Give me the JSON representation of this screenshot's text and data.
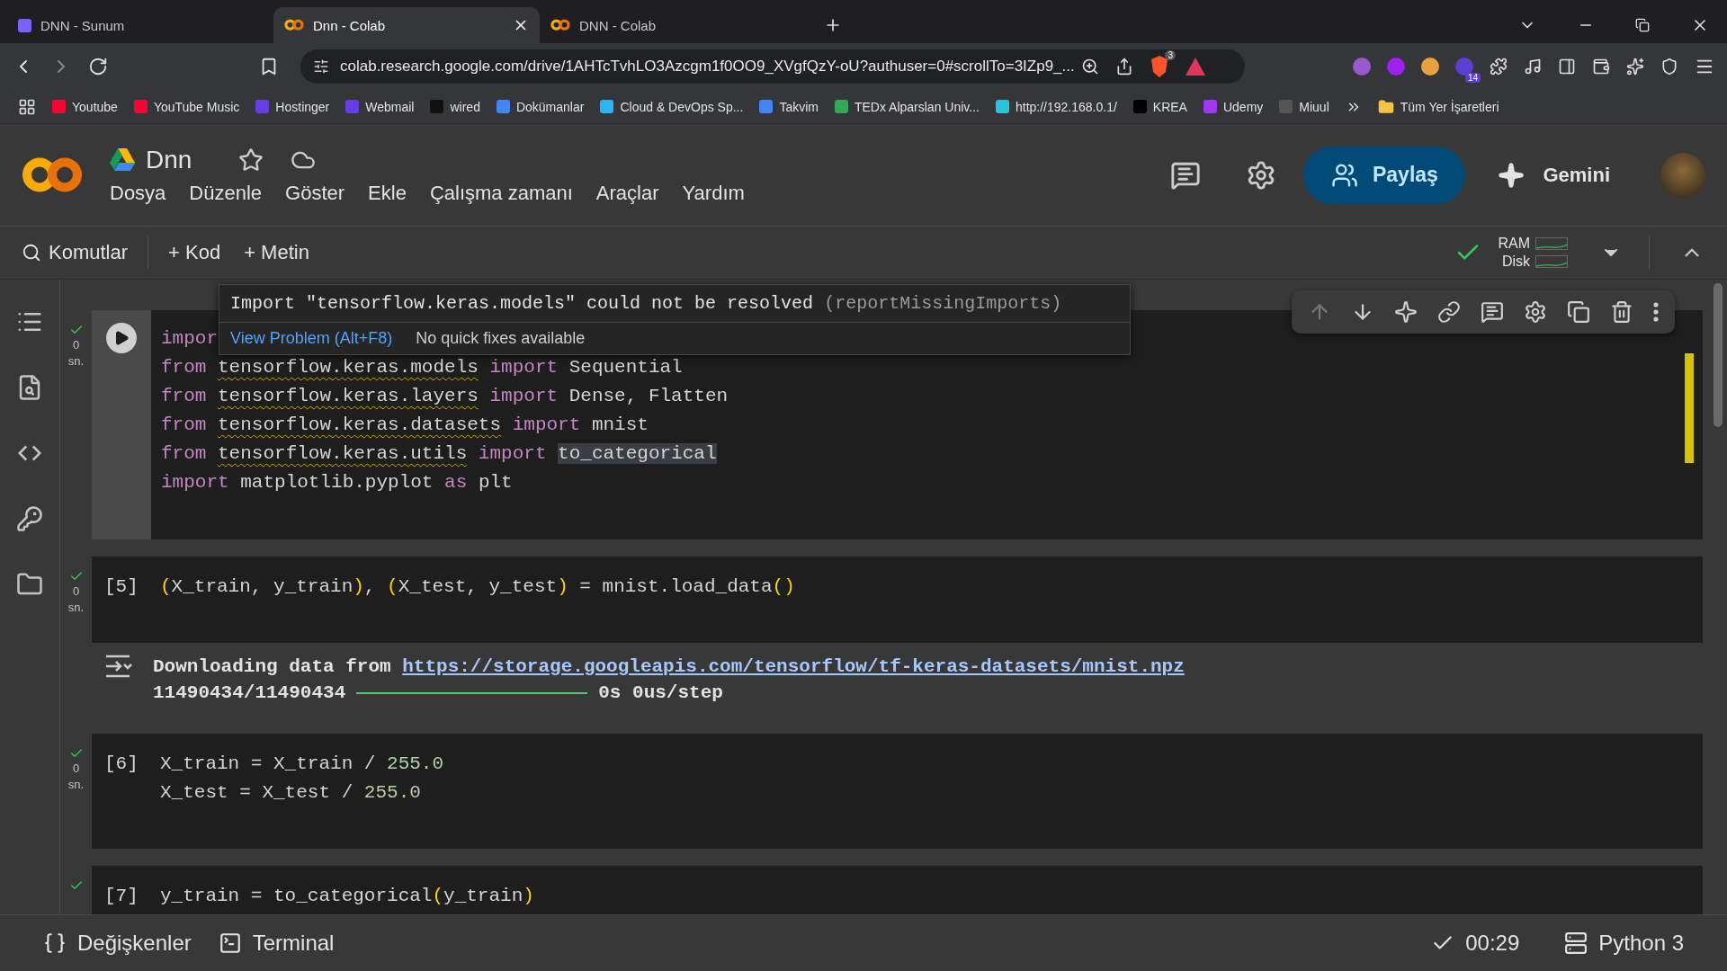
{
  "browser": {
    "tabs": [
      {
        "title": "DNN - Sunum",
        "selected": false,
        "kind": "slides"
      },
      {
        "title": "Dnn - Colab",
        "selected": true,
        "kind": "colab"
      },
      {
        "title": "DNN - Colab",
        "selected": false,
        "kind": "colab"
      }
    ],
    "url": "colab.research.google.com/drive/1AHTcTvhLO3Azcgm1f0OO9_XVgfQzY-oU?authuser=0#scrollTo=3IZp9_...",
    "shield_count": "3",
    "extensions": [
      {
        "color": "#9b59d0"
      },
      {
        "color": "#a020f0"
      },
      {
        "color": "#e8a33d"
      },
      {
        "color": "#5b3fd0",
        "badge": "14"
      }
    ],
    "bookmarks": [
      {
        "label": "Youtube",
        "color": "#ff0033"
      },
      {
        "label": "YouTube Music",
        "color": "#ff0033"
      },
      {
        "label": "Hostinger",
        "color": "#673de6"
      },
      {
        "label": "Webmail",
        "color": "#673de6"
      },
      {
        "label": "wired",
        "color": "#111111"
      },
      {
        "label": "Dokümanlar",
        "color": "#4285f4"
      },
      {
        "label": "Cloud & DevOps Sp...",
        "color": "#29b6f6"
      },
      {
        "label": "Takvim",
        "color": "#4285f4"
      },
      {
        "label": "TEDx Alparslan Univ...",
        "color": "#34a853"
      },
      {
        "label": "http://192.168.0.1/",
        "color": "#26c6da"
      },
      {
        "label": "KREA",
        "color": "#000000"
      },
      {
        "label": "Udemy",
        "color": "#a435f0"
      },
      {
        "label": "Miuul",
        "color": "#555555"
      }
    ],
    "all_bookmarks": "Tüm Yer İşaretleri"
  },
  "notebook": {
    "title": "Dnn",
    "menu": [
      "Dosya",
      "Düzenle",
      "Göster",
      "Ekle",
      "Çalışma zamanı",
      "Araçlar",
      "Yardım"
    ],
    "share": "Paylaş",
    "gemini": "Gemini",
    "toolbar": {
      "commands": "Komutlar",
      "add_code": "+ Kod",
      "add_text": "+ Metin",
      "ram": "RAM",
      "disk": "Disk"
    }
  },
  "cell_toolbar": [
    {
      "disabled": true
    },
    {
      "disabled": false
    },
    {
      "disabled": false
    },
    {
      "disabled": false
    },
    {
      "disabled": false
    },
    {
      "disabled": false
    },
    {
      "disabled": false
    },
    {
      "disabled": false
    },
    {
      "disabled": false
    }
  ],
  "tooltip": {
    "message": "Import \"tensorflow.keras.models\" could not be resolved",
    "rule": "(reportMissingImports)",
    "action": "View Problem (Alt+F8)",
    "note": "No quick fixes available"
  },
  "cells": [
    {
      "kind": "editor",
      "status": "0",
      "unit": "sn.",
      "lines": [
        [
          {
            "kind": "kw",
            "text": "impor"
          }
        ],
        [
          {
            "kind": "kw",
            "text": "from "
          },
          {
            "kind": "mod",
            "text": "tensorflow.keras.models"
          },
          {
            "kind": "kw",
            "text": " import "
          },
          {
            "kind": "plain",
            "text": "Sequential"
          }
        ],
        [
          {
            "kind": "kw",
            "text": "from "
          },
          {
            "kind": "mod",
            "text": "tensorflow.keras.layers"
          },
          {
            "kind": "kw",
            "text": " import "
          },
          {
            "kind": "plain",
            "text": "Dense, Flatten"
          }
        ],
        [
          {
            "kind": "kw",
            "text": "from "
          },
          {
            "kind": "mod",
            "text": "tensorflow.keras.datasets"
          },
          {
            "kind": "kw",
            "text": " import "
          },
          {
            "kind": "plain",
            "text": "mnist"
          }
        ],
        [
          {
            "kind": "kw",
            "text": "from "
          },
          {
            "kind": "mod",
            "text": "tensorflow.keras.utils"
          },
          {
            "kind": "kw",
            "text": " import "
          },
          {
            "kind": "hl",
            "text": "to_categorical"
          }
        ],
        [
          {
            "kind": "kw",
            "text": "import "
          },
          {
            "kind": "plain",
            "text": "matplotlib.pyplot "
          },
          {
            "kind": "kw",
            "text": "as "
          },
          {
            "kind": "plain",
            "text": "plt"
          }
        ]
      ]
    },
    {
      "kind": "code",
      "prompt": "[5]",
      "status": "0",
      "unit": "sn.",
      "lines": [
        [
          {
            "kind": "paren",
            "text": "("
          },
          {
            "kind": "plain",
            "text": "X_train, y_train"
          },
          {
            "kind": "paren",
            "text": ")"
          },
          {
            "kind": "plain",
            "text": ", "
          },
          {
            "kind": "paren",
            "text": "("
          },
          {
            "kind": "plain",
            "text": "X_test, y_test"
          },
          {
            "kind": "paren",
            "text": ")"
          },
          {
            "kind": "plain",
            "text": " = mnist.load_data"
          },
          {
            "kind": "paren",
            "text": "()"
          }
        ]
      ],
      "output": {
        "text": "Downloading data from ",
        "link": "https://storage.googleapis.com/tensorflow/tf-keras-datasets/mnist.npz",
        "count": "11490434/11490434",
        "level": 1,
        "speed": "0s 0us/step"
      }
    },
    {
      "kind": "code",
      "prompt": "[6]",
      "status": "0",
      "unit": "sn.",
      "lines": [
        [
          {
            "kind": "plain",
            "text": "X_train = X_train / "
          },
          {
            "kind": "num",
            "text": "255.0"
          }
        ],
        [
          {
            "kind": "plain",
            "text": "X_test = X_test / "
          },
          {
            "kind": "num",
            "text": "255.0"
          }
        ]
      ]
    },
    {
      "kind": "code",
      "prompt": "[7]",
      "lines": [
        [
          {
            "kind": "plain",
            "text": "y_train = to_categorical"
          },
          {
            "kind": "paren",
            "text": "("
          },
          {
            "kind": "plain",
            "text": "y_train"
          },
          {
            "kind": "paren",
            "text": ")"
          }
        ]
      ]
    }
  ],
  "status_bar": {
    "variables": "Değişkenler",
    "terminal": "Terminal",
    "elapsed": "00:29",
    "runtime": "Python 3"
  }
}
